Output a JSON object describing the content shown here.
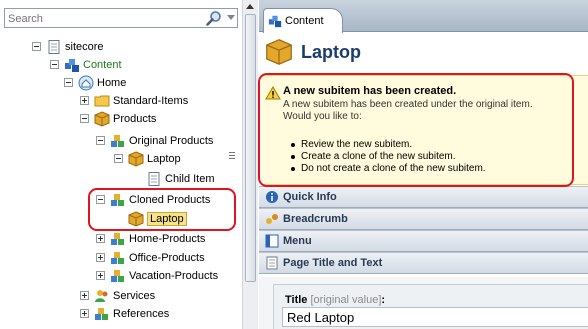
{
  "search": {
    "placeholder": "Search"
  },
  "tree": {
    "items": [
      {
        "label": "sitecore",
        "icon": "page-icon"
      },
      {
        "label": "Content",
        "icon": "content-icon"
      },
      {
        "label": "Home",
        "icon": "home-icon"
      },
      {
        "label": "Standard-Items",
        "icon": "folder-icon"
      },
      {
        "label": "Products",
        "icon": "cube-icon"
      },
      {
        "label": "Original Products",
        "icon": "blocks-icon"
      },
      {
        "label": "Laptop",
        "icon": "cube-icon"
      },
      {
        "label": "Child Item",
        "icon": "page-icon"
      },
      {
        "label": "Cloned Products",
        "icon": "blocks-icon"
      },
      {
        "label": "Laptop",
        "icon": "cube-icon",
        "selected": true
      },
      {
        "label": "Home-Products",
        "icon": "blocks-icon"
      },
      {
        "label": "Office-Products",
        "icon": "blocks-icon"
      },
      {
        "label": "Vacation-Products",
        "icon": "blocks-icon"
      },
      {
        "label": "Services",
        "icon": "people-icon"
      },
      {
        "label": "References",
        "icon": "blocks-icon"
      }
    ]
  },
  "tabs": {
    "content_label": "Content"
  },
  "item": {
    "title": "Laptop"
  },
  "warning": {
    "title": "A new subitem has been created.",
    "text_line1": "A new subitem has been created under the original item.",
    "text_line2": "Would you like to:",
    "options": [
      "Review the new subitem.",
      "Create a clone of the new subitem.",
      "Do not create a clone of the new subitem."
    ]
  },
  "sections": [
    {
      "title": "Quick Info",
      "icon": "info-icon"
    },
    {
      "title": "Breadcrumb",
      "icon": "breadcrumb-icon"
    },
    {
      "title": "Menu",
      "icon": "menu-icon"
    },
    {
      "title": "Page Title and Text",
      "icon": "page-icon"
    }
  ],
  "field": {
    "label": "Title",
    "hint": "[original value]",
    "colon": ":",
    "value": "Red Laptop"
  },
  "colors": {
    "callout": "#e0141e",
    "warning_bg": "#fffbdc",
    "selection": "#f5e28a",
    "content_green": "#1f7a1f"
  }
}
